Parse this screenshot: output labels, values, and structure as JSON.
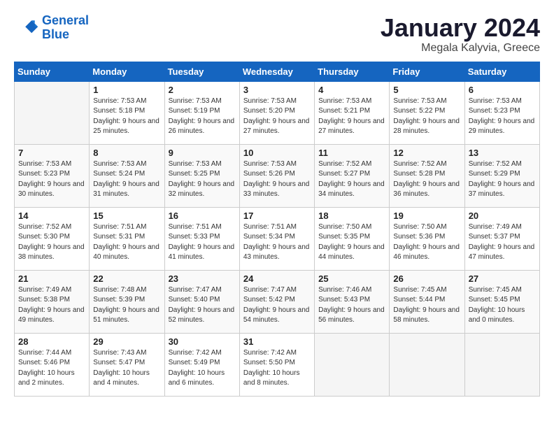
{
  "logo": {
    "line1": "General",
    "line2": "Blue"
  },
  "title": "January 2024",
  "location": "Megala Kalyvia, Greece",
  "days_header": [
    "Sunday",
    "Monday",
    "Tuesday",
    "Wednesday",
    "Thursday",
    "Friday",
    "Saturday"
  ],
  "weeks": [
    [
      {
        "day": "",
        "sunrise": "",
        "sunset": "",
        "daylight": ""
      },
      {
        "day": "1",
        "sunrise": "Sunrise: 7:53 AM",
        "sunset": "Sunset: 5:18 PM",
        "daylight": "Daylight: 9 hours and 25 minutes."
      },
      {
        "day": "2",
        "sunrise": "Sunrise: 7:53 AM",
        "sunset": "Sunset: 5:19 PM",
        "daylight": "Daylight: 9 hours and 26 minutes."
      },
      {
        "day": "3",
        "sunrise": "Sunrise: 7:53 AM",
        "sunset": "Sunset: 5:20 PM",
        "daylight": "Daylight: 9 hours and 27 minutes."
      },
      {
        "day": "4",
        "sunrise": "Sunrise: 7:53 AM",
        "sunset": "Sunset: 5:21 PM",
        "daylight": "Daylight: 9 hours and 27 minutes."
      },
      {
        "day": "5",
        "sunrise": "Sunrise: 7:53 AM",
        "sunset": "Sunset: 5:22 PM",
        "daylight": "Daylight: 9 hours and 28 minutes."
      },
      {
        "day": "6",
        "sunrise": "Sunrise: 7:53 AM",
        "sunset": "Sunset: 5:23 PM",
        "daylight": "Daylight: 9 hours and 29 minutes."
      }
    ],
    [
      {
        "day": "7",
        "sunrise": "Sunrise: 7:53 AM",
        "sunset": "Sunset: 5:23 PM",
        "daylight": "Daylight: 9 hours and 30 minutes."
      },
      {
        "day": "8",
        "sunrise": "Sunrise: 7:53 AM",
        "sunset": "Sunset: 5:24 PM",
        "daylight": "Daylight: 9 hours and 31 minutes."
      },
      {
        "day": "9",
        "sunrise": "Sunrise: 7:53 AM",
        "sunset": "Sunset: 5:25 PM",
        "daylight": "Daylight: 9 hours and 32 minutes."
      },
      {
        "day": "10",
        "sunrise": "Sunrise: 7:53 AM",
        "sunset": "Sunset: 5:26 PM",
        "daylight": "Daylight: 9 hours and 33 minutes."
      },
      {
        "day": "11",
        "sunrise": "Sunrise: 7:52 AM",
        "sunset": "Sunset: 5:27 PM",
        "daylight": "Daylight: 9 hours and 34 minutes."
      },
      {
        "day": "12",
        "sunrise": "Sunrise: 7:52 AM",
        "sunset": "Sunset: 5:28 PM",
        "daylight": "Daylight: 9 hours and 36 minutes."
      },
      {
        "day": "13",
        "sunrise": "Sunrise: 7:52 AM",
        "sunset": "Sunset: 5:29 PM",
        "daylight": "Daylight: 9 hours and 37 minutes."
      }
    ],
    [
      {
        "day": "14",
        "sunrise": "Sunrise: 7:52 AM",
        "sunset": "Sunset: 5:30 PM",
        "daylight": "Daylight: 9 hours and 38 minutes."
      },
      {
        "day": "15",
        "sunrise": "Sunrise: 7:51 AM",
        "sunset": "Sunset: 5:31 PM",
        "daylight": "Daylight: 9 hours and 40 minutes."
      },
      {
        "day": "16",
        "sunrise": "Sunrise: 7:51 AM",
        "sunset": "Sunset: 5:33 PM",
        "daylight": "Daylight: 9 hours and 41 minutes."
      },
      {
        "day": "17",
        "sunrise": "Sunrise: 7:51 AM",
        "sunset": "Sunset: 5:34 PM",
        "daylight": "Daylight: 9 hours and 43 minutes."
      },
      {
        "day": "18",
        "sunrise": "Sunrise: 7:50 AM",
        "sunset": "Sunset: 5:35 PM",
        "daylight": "Daylight: 9 hours and 44 minutes."
      },
      {
        "day": "19",
        "sunrise": "Sunrise: 7:50 AM",
        "sunset": "Sunset: 5:36 PM",
        "daylight": "Daylight: 9 hours and 46 minutes."
      },
      {
        "day": "20",
        "sunrise": "Sunrise: 7:49 AM",
        "sunset": "Sunset: 5:37 PM",
        "daylight": "Daylight: 9 hours and 47 minutes."
      }
    ],
    [
      {
        "day": "21",
        "sunrise": "Sunrise: 7:49 AM",
        "sunset": "Sunset: 5:38 PM",
        "daylight": "Daylight: 9 hours and 49 minutes."
      },
      {
        "day": "22",
        "sunrise": "Sunrise: 7:48 AM",
        "sunset": "Sunset: 5:39 PM",
        "daylight": "Daylight: 9 hours and 51 minutes."
      },
      {
        "day": "23",
        "sunrise": "Sunrise: 7:47 AM",
        "sunset": "Sunset: 5:40 PM",
        "daylight": "Daylight: 9 hours and 52 minutes."
      },
      {
        "day": "24",
        "sunrise": "Sunrise: 7:47 AM",
        "sunset": "Sunset: 5:42 PM",
        "daylight": "Daylight: 9 hours and 54 minutes."
      },
      {
        "day": "25",
        "sunrise": "Sunrise: 7:46 AM",
        "sunset": "Sunset: 5:43 PM",
        "daylight": "Daylight: 9 hours and 56 minutes."
      },
      {
        "day": "26",
        "sunrise": "Sunrise: 7:45 AM",
        "sunset": "Sunset: 5:44 PM",
        "daylight": "Daylight: 9 hours and 58 minutes."
      },
      {
        "day": "27",
        "sunrise": "Sunrise: 7:45 AM",
        "sunset": "Sunset: 5:45 PM",
        "daylight": "Daylight: 10 hours and 0 minutes."
      }
    ],
    [
      {
        "day": "28",
        "sunrise": "Sunrise: 7:44 AM",
        "sunset": "Sunset: 5:46 PM",
        "daylight": "Daylight: 10 hours and 2 minutes."
      },
      {
        "day": "29",
        "sunrise": "Sunrise: 7:43 AM",
        "sunset": "Sunset: 5:47 PM",
        "daylight": "Daylight: 10 hours and 4 minutes."
      },
      {
        "day": "30",
        "sunrise": "Sunrise: 7:42 AM",
        "sunset": "Sunset: 5:49 PM",
        "daylight": "Daylight: 10 hours and 6 minutes."
      },
      {
        "day": "31",
        "sunrise": "Sunrise: 7:42 AM",
        "sunset": "Sunset: 5:50 PM",
        "daylight": "Daylight: 10 hours and 8 minutes."
      },
      {
        "day": "",
        "sunrise": "",
        "sunset": "",
        "daylight": ""
      },
      {
        "day": "",
        "sunrise": "",
        "sunset": "",
        "daylight": ""
      },
      {
        "day": "",
        "sunrise": "",
        "sunset": "",
        "daylight": ""
      }
    ]
  ]
}
